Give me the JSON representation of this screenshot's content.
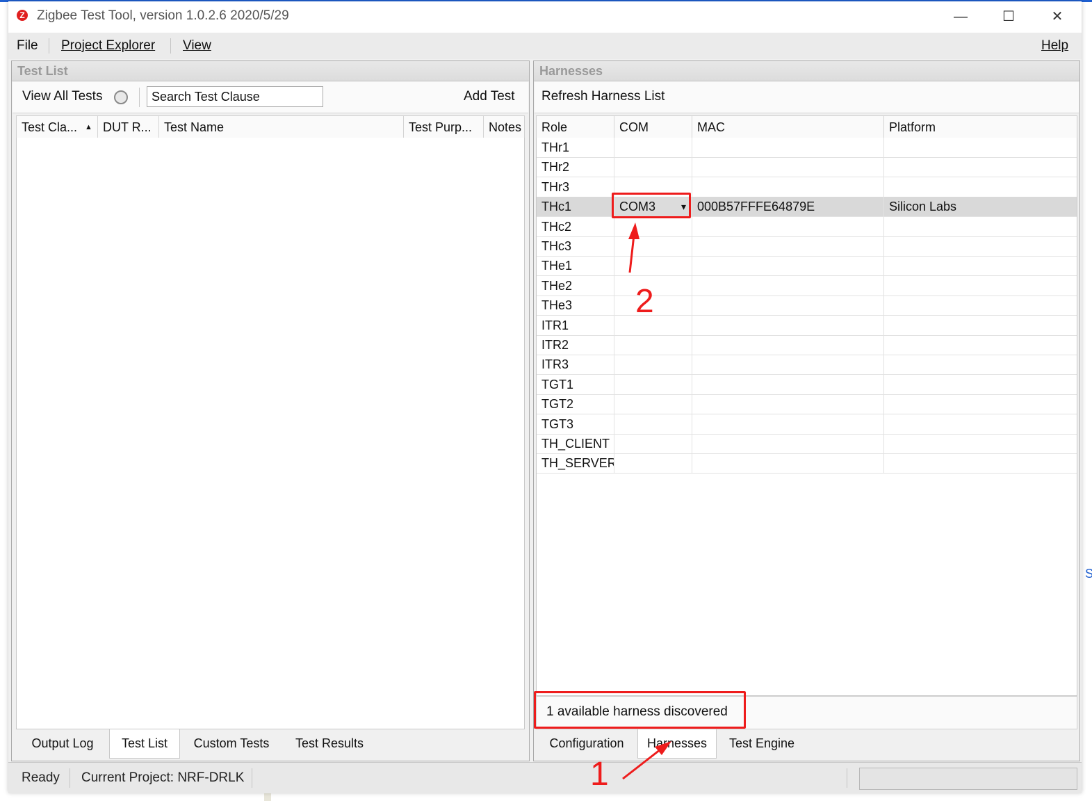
{
  "window": {
    "title": "Zigbee Test Tool, version 1.0.2.6 2020/5/29",
    "icon": "zigbee-logo-icon",
    "controls": [
      "minimize",
      "maximize",
      "close"
    ]
  },
  "menu": {
    "file": "File",
    "project_explorer": "Project Explorer",
    "view": "View",
    "help": "Help"
  },
  "test_list": {
    "title": "Test List",
    "view_all_label": "View All Tests",
    "search_placeholder": "Search Test Clause",
    "add_label": "Add Test",
    "columns": [
      "Test Cla...",
      "DUT R...",
      "Test Name",
      "Test Purp...",
      "Notes"
    ]
  },
  "left_tabs": [
    "Output Log",
    "Test List",
    "Custom Tests",
    "Test Results"
  ],
  "harnesses": {
    "title": "Harnesses",
    "refresh_label": "Refresh Harness List",
    "columns": [
      "Role",
      "COM",
      "MAC",
      "Platform"
    ],
    "rows": [
      {
        "role": "THr1",
        "com": "",
        "mac": "",
        "platform": ""
      },
      {
        "role": "THr2",
        "com": "",
        "mac": "",
        "platform": ""
      },
      {
        "role": "THr3",
        "com": "",
        "mac": "",
        "platform": ""
      },
      {
        "role": "THc1",
        "com": "COM3",
        "mac": "000B57FFFE64879E",
        "platform": "Silicon Labs"
      },
      {
        "role": "THc2",
        "com": "",
        "mac": "",
        "platform": ""
      },
      {
        "role": "THc3",
        "com": "",
        "mac": "",
        "platform": ""
      },
      {
        "role": "THe1",
        "com": "",
        "mac": "",
        "platform": ""
      },
      {
        "role": "THe2",
        "com": "",
        "mac": "",
        "platform": ""
      },
      {
        "role": "THe3",
        "com": "",
        "mac": "",
        "platform": ""
      },
      {
        "role": "ITR1",
        "com": "",
        "mac": "",
        "platform": ""
      },
      {
        "role": "ITR2",
        "com": "",
        "mac": "",
        "platform": ""
      },
      {
        "role": "ITR3",
        "com": "",
        "mac": "",
        "platform": ""
      },
      {
        "role": "TGT1",
        "com": "",
        "mac": "",
        "platform": ""
      },
      {
        "role": "TGT2",
        "com": "",
        "mac": "",
        "platform": ""
      },
      {
        "role": "TGT3",
        "com": "",
        "mac": "",
        "platform": ""
      },
      {
        "role": "TH_CLIENT",
        "com": "",
        "mac": "",
        "platform": ""
      },
      {
        "role": "TH_SERVER",
        "com": "",
        "mac": "",
        "platform": ""
      }
    ],
    "status": "1 available harness discovered"
  },
  "right_tabs": [
    "Configuration",
    "Harnesses",
    "Test Engine"
  ],
  "statusbar": {
    "ready": "Ready",
    "project": "Current Project: NRF-DRLK"
  },
  "annotations": {
    "one": "1",
    "two": "2",
    "color": "#ee1c1c"
  }
}
